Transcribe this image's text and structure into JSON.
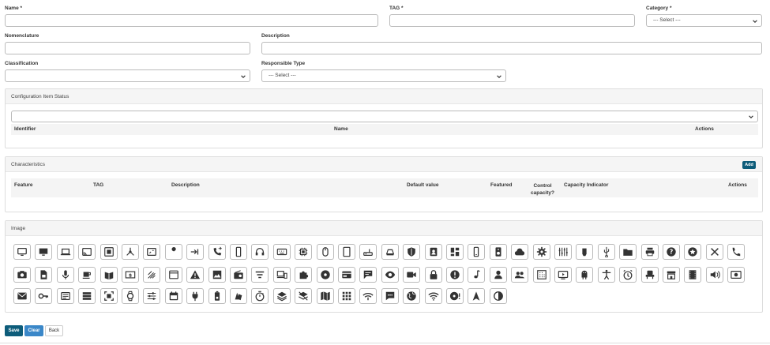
{
  "fields": {
    "name_label": "Name *",
    "tag_label": "TAG *",
    "category_label": "Category *",
    "category_value": "--- Select ---",
    "nomenclature_label": "Nomenclature",
    "description_label": "Description",
    "classification_label": "Classification",
    "responsible_type_label": "Responsible Type",
    "responsible_type_value": "--- Select ---"
  },
  "status_panel": {
    "title": "Configuration Item Status",
    "columns": [
      "Identifier",
      "Name",
      "Actions"
    ]
  },
  "characteristics_panel": {
    "title": "Characteristics",
    "add_label": "Add",
    "columns": [
      "Feature",
      "TAG",
      "Description",
      "Default value",
      "Featured",
      "Control capacity?",
      "Capacity Indicator",
      "Actions"
    ]
  },
  "image_panel": {
    "title": "Image",
    "icons": [
      [
        "monitor-icon",
        "desktop-icon",
        "laptop-icon",
        "cast-icon",
        "chip-board-icon",
        "network-hub-icon",
        "screen-icon",
        "wrench-icon",
        "input-icon",
        "phone-forward-icon",
        "smartphone-icon",
        "headphones-icon",
        "keyboard-icon",
        "cpu-icon",
        "mouse-icon",
        "tablet-icon",
        "router-icon",
        "hard-drive-icon",
        "shield-icon",
        "badge-icon",
        "dashboard-icon",
        "mobile-icon",
        "speaker-icon",
        "cloud-icon",
        "gear-icon",
        "equalizer-icon",
        "memory-icon",
        "usb-icon",
        "folder-icon",
        "printer-icon",
        "help-icon",
        "star-icon",
        "tools-icon",
        "phone-icon"
      ],
      [
        "camera-icon",
        "sim-card-icon",
        "microphone-icon",
        "coffee-icon",
        "book-icon",
        "money-icon",
        "antenna-icon",
        "browser-icon",
        "warning-icon",
        "image-icon",
        "radio-icon",
        "filter-icon",
        "devices-icon",
        "puzzle-icon",
        "disc-icon",
        "card-icon",
        "chat-icon",
        "eye-icon",
        "video-icon",
        "lock-icon",
        "alert-icon",
        "music-icon",
        "person-icon",
        "group-icon",
        "building-icon",
        "tv-play-icon",
        "android-icon",
        "accessibility-icon",
        "alarm-icon",
        "seat-icon",
        "store-icon",
        "film-icon",
        "volume-icon",
        "cash-icon"
      ],
      [
        "mail-icon",
        "key-icon",
        "message-box-icon",
        "list-icon",
        "scan-icon",
        "watch-icon",
        "sliders-icon",
        "calendar-icon",
        "plug-icon",
        "battery-icon",
        "shapes-icon",
        "timer-icon",
        "layers-icon",
        "layers-off-icon",
        "map-icon",
        "grid-icon",
        "wifi-off-icon",
        "comment-icon",
        "globe-icon",
        "wifi-icon",
        "album-alert-icon",
        "navigation-icon",
        "contrast-icon"
      ]
    ]
  },
  "actions": {
    "save": "Save",
    "clear": "Clear",
    "back": "Back"
  }
}
